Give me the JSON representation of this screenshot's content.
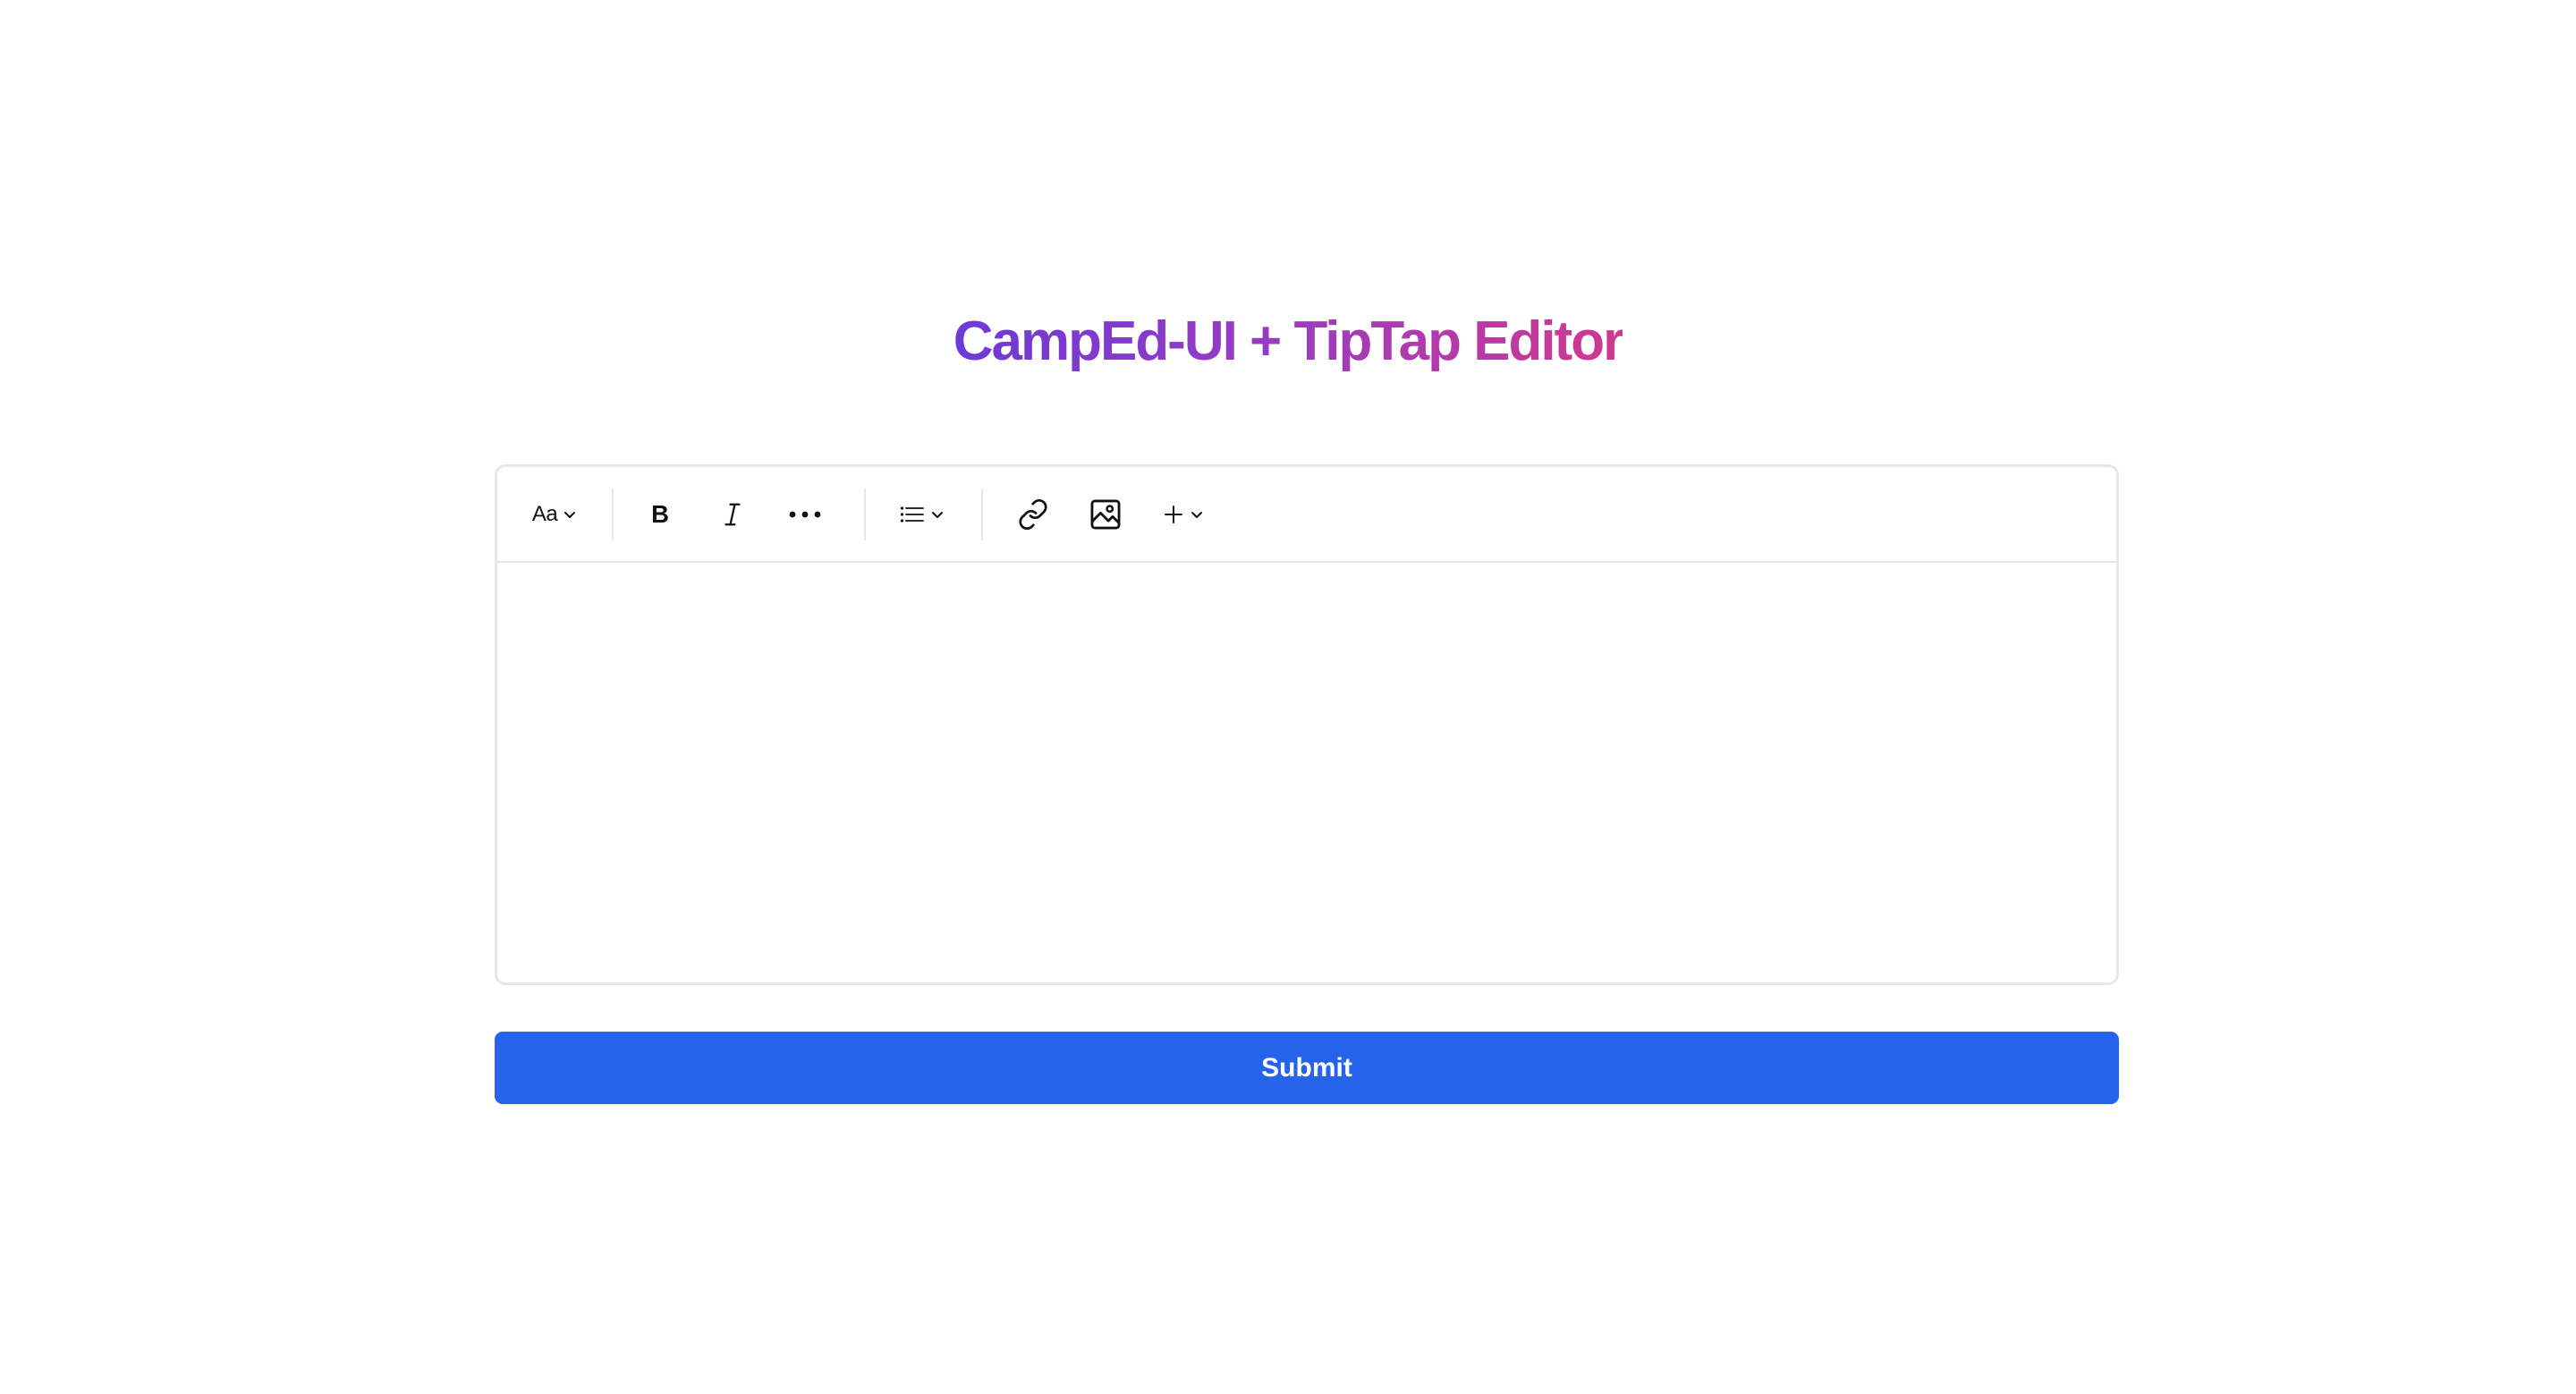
{
  "header": {
    "title": "CampEd-UI + TipTap Editor"
  },
  "toolbar": {
    "text_style_label": "Aa",
    "tools": [
      {
        "name": "text-style-dropdown",
        "icon": "chevron-down-icon"
      },
      {
        "name": "bold",
        "icon": "bold-icon"
      },
      {
        "name": "italic",
        "icon": "italic-icon"
      },
      {
        "name": "more-formatting",
        "icon": "more-horizontal-icon"
      },
      {
        "name": "list-dropdown",
        "icon": "list-icon"
      },
      {
        "name": "link",
        "icon": "link-icon"
      },
      {
        "name": "image",
        "icon": "image-icon"
      },
      {
        "name": "insert-dropdown",
        "icon": "plus-icon"
      }
    ]
  },
  "editor": {
    "content": ""
  },
  "actions": {
    "submit_label": "Submit"
  },
  "colors": {
    "title_gradient_start": "#6d3ad6",
    "title_gradient_end": "#cf3a8e",
    "submit_background": "#2563eb",
    "border": "#e5e7eb"
  }
}
